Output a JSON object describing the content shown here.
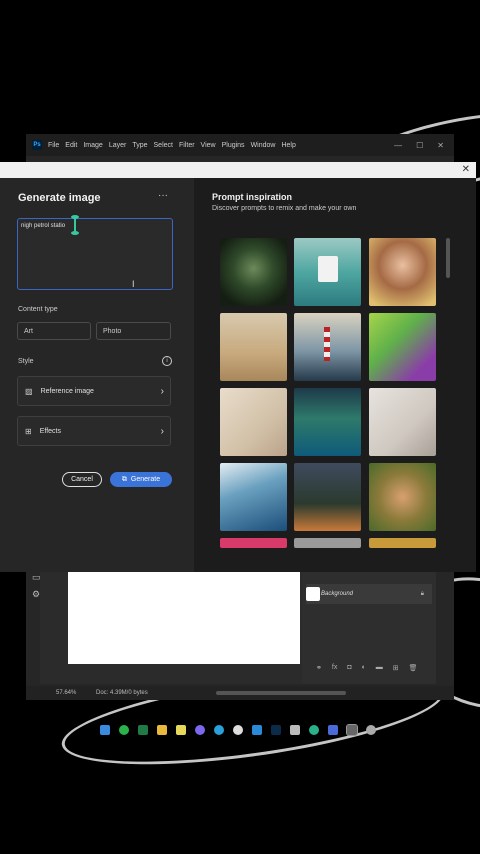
{
  "photoshop": {
    "menu": [
      "File",
      "Edit",
      "Image",
      "Layer",
      "Type",
      "Select",
      "Filter",
      "View",
      "Plugins",
      "Window",
      "Help"
    ],
    "logo": "Ps",
    "window_controls": [
      "—",
      "☐",
      "✕"
    ],
    "layer_name": "Background",
    "zoom": "57.64%",
    "doc_info": "Doc: 4.39M/0 bytes"
  },
  "dialog": {
    "close": "✕",
    "title": "Generate image",
    "more": "···",
    "prompt_value": "nigh petrol statio",
    "content_type_label": "Content type",
    "content_type_options": [
      "Art",
      "Photo"
    ],
    "style_label": "Style",
    "info": "i",
    "reference_image_label": "Reference image",
    "effects_label": "Effects",
    "cancel_label": "Cancel",
    "generate_label": "Generate",
    "inspiration_title": "Prompt inspiration",
    "inspiration_subtitle": "Discover prompts to remix and make your own"
  },
  "colors": {
    "accent": "#3b74d8",
    "dialog_bg": "#232323",
    "panel_bg": "#1c1c1c"
  }
}
